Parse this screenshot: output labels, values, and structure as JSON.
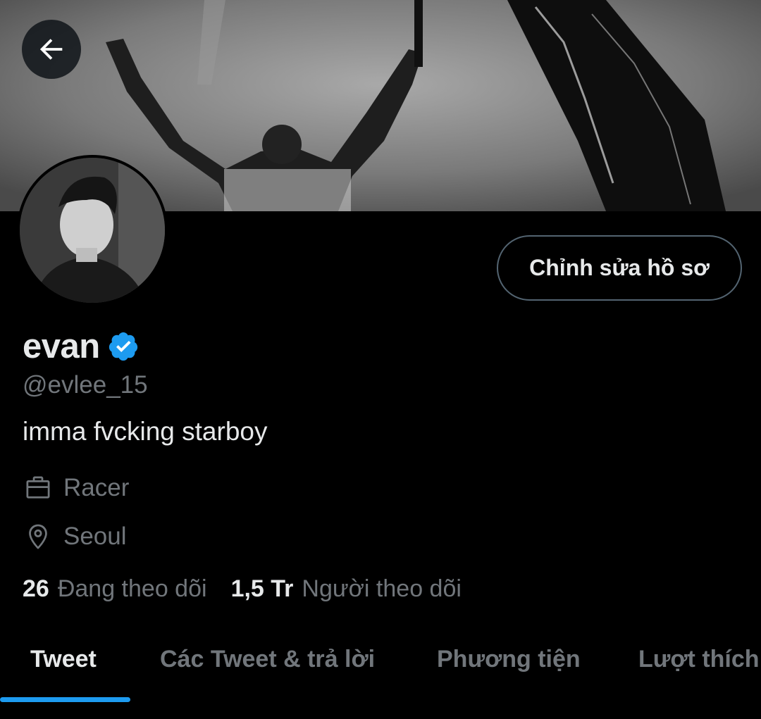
{
  "header": {
    "back_icon": "arrow-left-icon",
    "banner": "header-photo"
  },
  "profile": {
    "display_name": "evan",
    "verified_icon": "verified-badge-icon",
    "handle": "@evlee_15",
    "bio": "imma fvcking starboy",
    "work_icon": "briefcase-icon",
    "work": "Racer",
    "location_icon": "location-pin-icon",
    "location": "Seoul",
    "edit_button_label": "Chỉnh sửa hồ sơ"
  },
  "stats": {
    "following_count": "26",
    "following_label": "Đang theo dõi",
    "followers_count": "1,5 Tr",
    "followers_label": "Người theo dõi"
  },
  "tabs": [
    {
      "label": "Tweet",
      "active": true
    },
    {
      "label": "Các Tweet & trả lời",
      "active": false
    },
    {
      "label": "Phương tiện",
      "active": false
    },
    {
      "label": "Lượt thích",
      "active": false
    }
  ],
  "colors": {
    "accent": "#1d9bf0",
    "background": "#000000",
    "text_primary": "#e7e9ea",
    "text_secondary": "#71767b",
    "border": "#536471"
  }
}
